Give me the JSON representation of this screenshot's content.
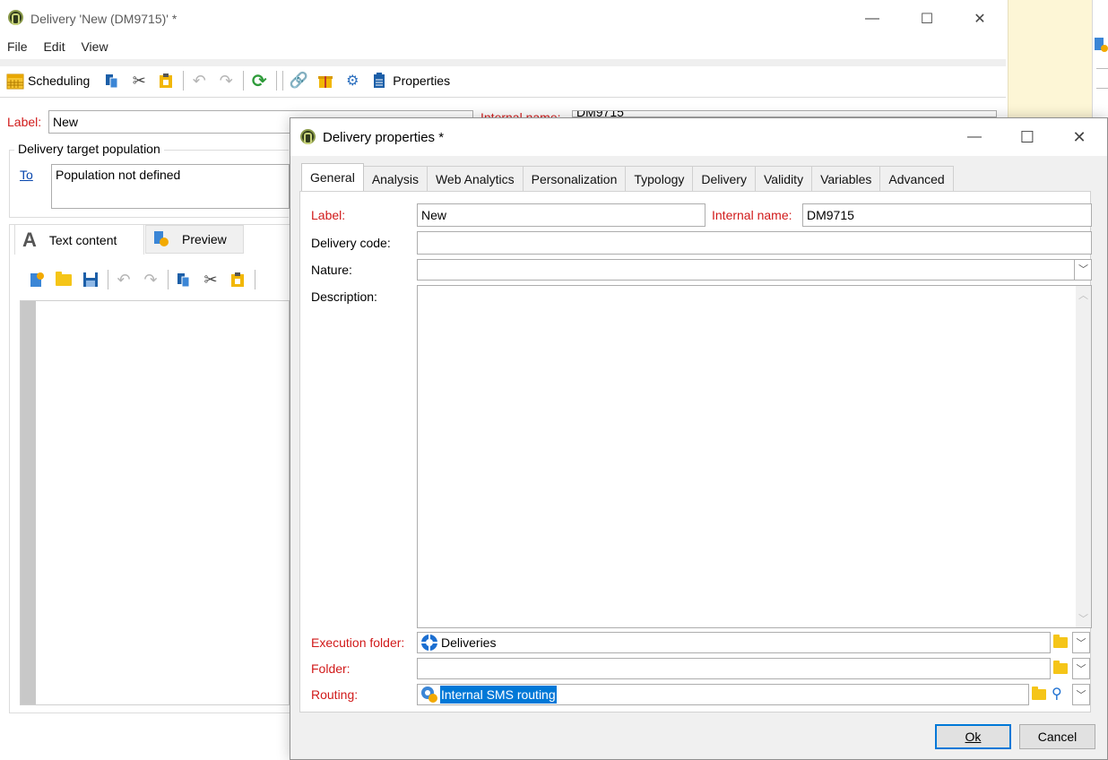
{
  "main_window": {
    "title": "Delivery 'New (DM9715)' *",
    "controls": {
      "minimize": "—",
      "maximize": "☐",
      "close": "✕"
    },
    "menu": [
      "File",
      "Edit",
      "View"
    ],
    "toolbar": {
      "scheduling": "Scheduling",
      "properties": "Properties"
    },
    "label_caption": "Label:",
    "label_value": "New",
    "internal_name_partial": "Internal name:",
    "internal_value_partial": "DM9715",
    "target_group": "Delivery target population",
    "to_link": "To",
    "population_text": "Population not defined",
    "content_tabs": {
      "text": "Text content",
      "preview": "Preview"
    }
  },
  "dialog": {
    "title": "Delivery properties *",
    "controls": {
      "minimize": "—",
      "maximize": "☐",
      "close": "✕"
    },
    "tabs": [
      "General",
      "Analysis",
      "Web Analytics",
      "Personalization",
      "Typology",
      "Delivery",
      "Validity",
      "Variables",
      "Advanced"
    ],
    "active_tab": "General",
    "fields": {
      "label": {
        "caption": "Label:",
        "value": "New"
      },
      "internal_name": {
        "caption": "Internal name:",
        "value": "DM9715"
      },
      "delivery_code": {
        "caption": "Delivery code:",
        "value": ""
      },
      "nature": {
        "caption": "Nature:",
        "value": ""
      },
      "description": {
        "caption": "Description:",
        "value": ""
      },
      "execution_folder": {
        "caption": "Execution folder:",
        "value": "Deliveries"
      },
      "folder": {
        "caption": "Folder:",
        "value": ""
      },
      "routing": {
        "caption": "Routing:",
        "value": "Internal SMS routing"
      }
    },
    "buttons": {
      "ok": "Ok",
      "cancel": "Cancel"
    }
  },
  "colors": {
    "required_label": "#d11a1a",
    "link": "#0645ad",
    "selection": "#0078d7",
    "accent_border": "#0078d7",
    "folder": "#f5c518"
  }
}
